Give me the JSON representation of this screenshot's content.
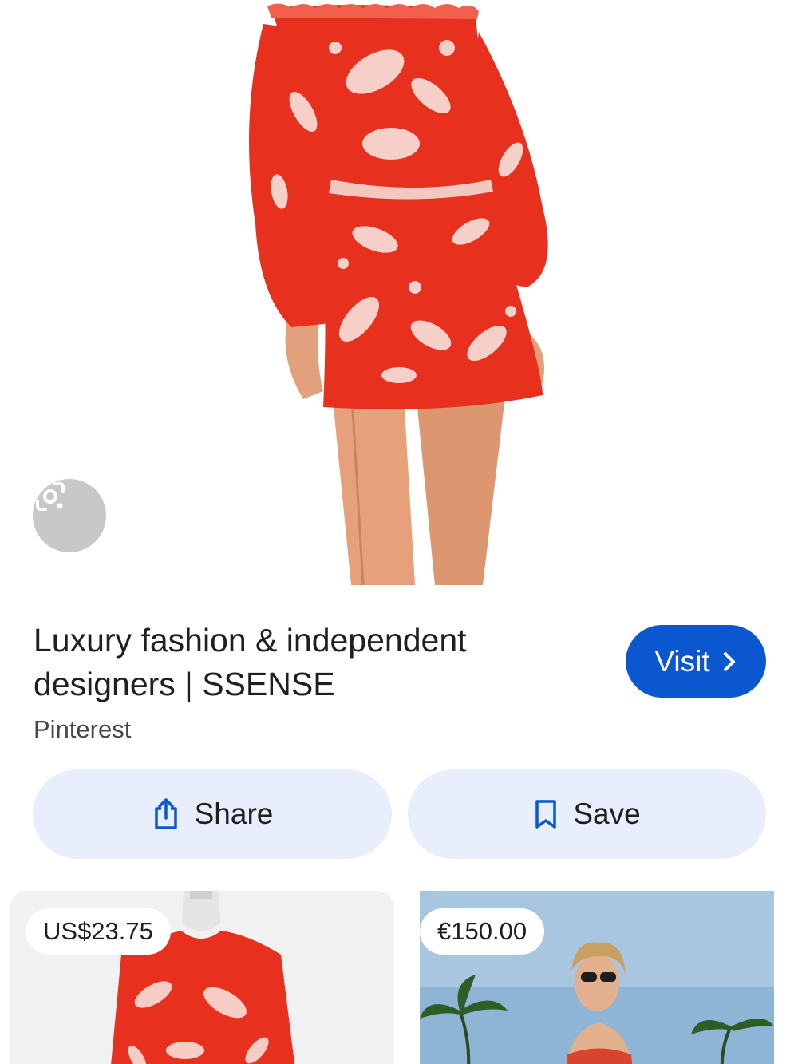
{
  "hero": {
    "lens_icon": "google-lens-icon"
  },
  "result": {
    "title": "Luxury fashion & independent designers | SSENSE",
    "source": "Pinterest",
    "visit_label": "Visit",
    "visit_icon": "chevron-right-icon"
  },
  "actions": {
    "share_label": "Share",
    "share_icon": "share-icon",
    "save_label": "Save",
    "save_icon": "bookmark-icon"
  },
  "related": [
    {
      "price": "US$23.75"
    },
    {
      "price": "€150.00"
    }
  ],
  "colors": {
    "accent": "#0b57d0",
    "action_bg": "#e8eefc",
    "dress_red": "#e8301f"
  }
}
